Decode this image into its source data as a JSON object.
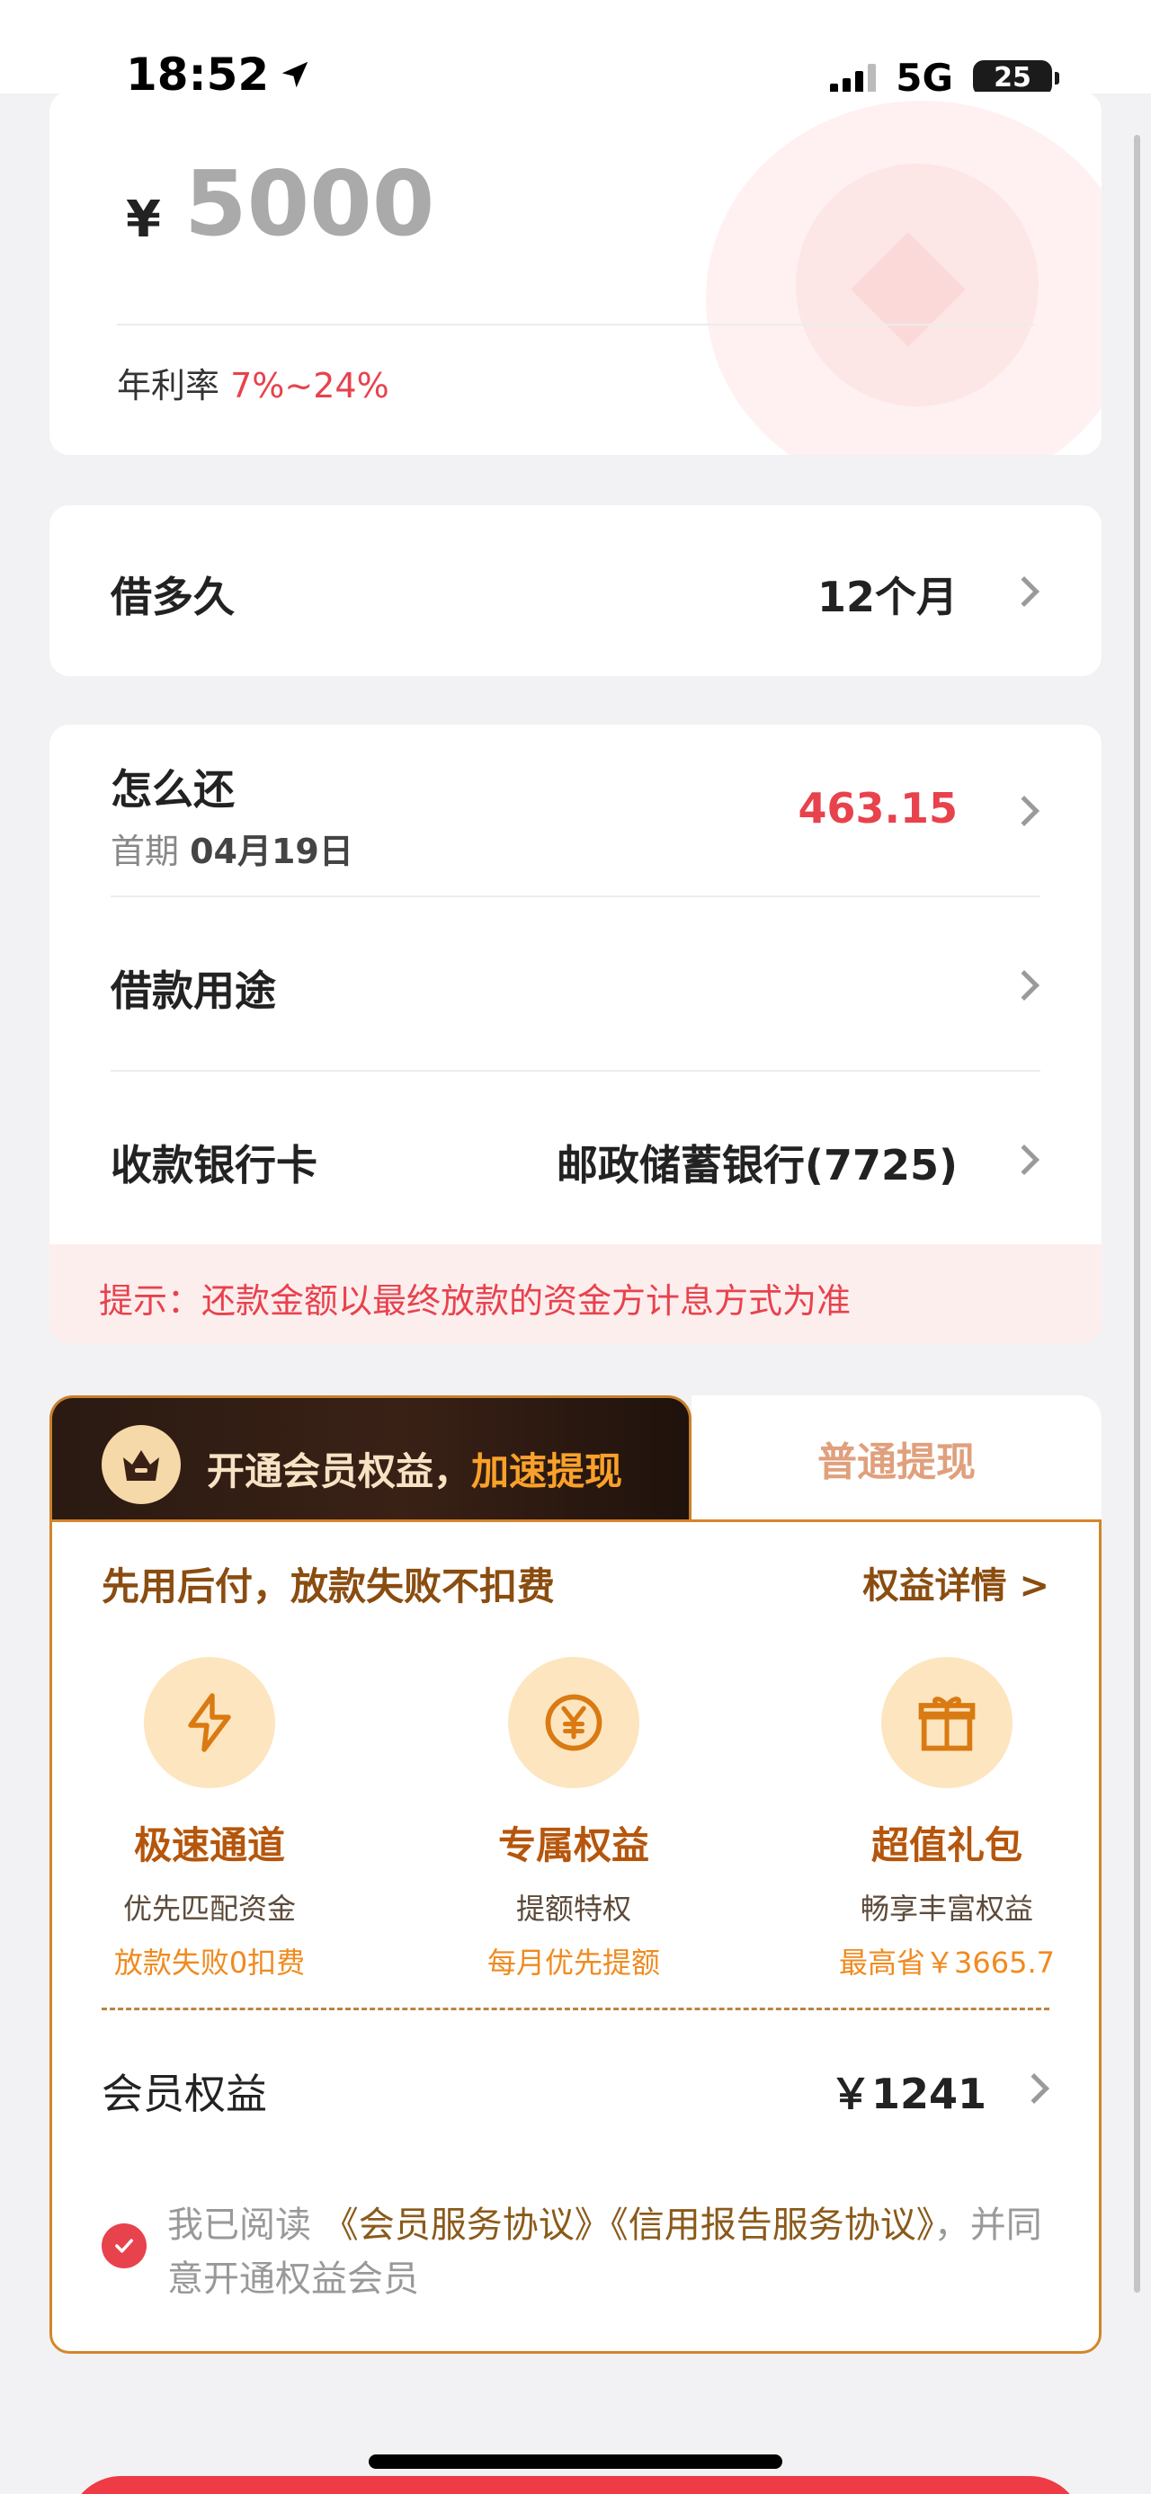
{
  "status_bar": {
    "time": "18:52",
    "network": "5G",
    "battery": "25"
  },
  "amount_card": {
    "currency": "¥",
    "amount": "5000",
    "rate_label": "年利率",
    "rate_value": "7%~24%"
  },
  "term": {
    "label": "借多久",
    "value": "12个月"
  },
  "repay": {
    "label": "怎么还",
    "first_prefix": "首期",
    "first_date": "04月19日",
    "amount": "463.15"
  },
  "purpose": {
    "label": "借款用途"
  },
  "bank": {
    "label": "收款银行卡",
    "value": "邮政储蓄银行(7725)"
  },
  "tip": {
    "text": "提示：还款金额以最终放款的资金方计息方式为准"
  },
  "member": {
    "tab_active": "开通会员权益，",
    "tab_active_highlight": "加速提现",
    "tab_normal": "普通提现",
    "title": "先用后付，放款失败不扣费",
    "details_link": "权益详情 >",
    "benefits": [
      {
        "icon": "lightning-icon",
        "title": "极速通道",
        "desc": "优先匹配资金",
        "note": "放款失败0扣费"
      },
      {
        "icon": "yen-coin-icon",
        "title": "专属权益",
        "desc": "提额特权",
        "note": "每月优先提额"
      },
      {
        "icon": "gift-icon",
        "title": "超值礼包",
        "desc": "畅享丰富权益",
        "note": "最高省￥3665.7"
      }
    ],
    "fee_label": "会员权益",
    "fee_value": "￥1241",
    "agree_prefix": "我已阅读 ",
    "agree_link1": "《会员服务协议》",
    "agree_link2": "《信用报告服务协议》",
    "agree_suffix": "，并同意开通权益会员"
  },
  "colors": {
    "accent_red": "#e8424d",
    "gold": "#d3862b",
    "brown": "#8a4d10"
  }
}
